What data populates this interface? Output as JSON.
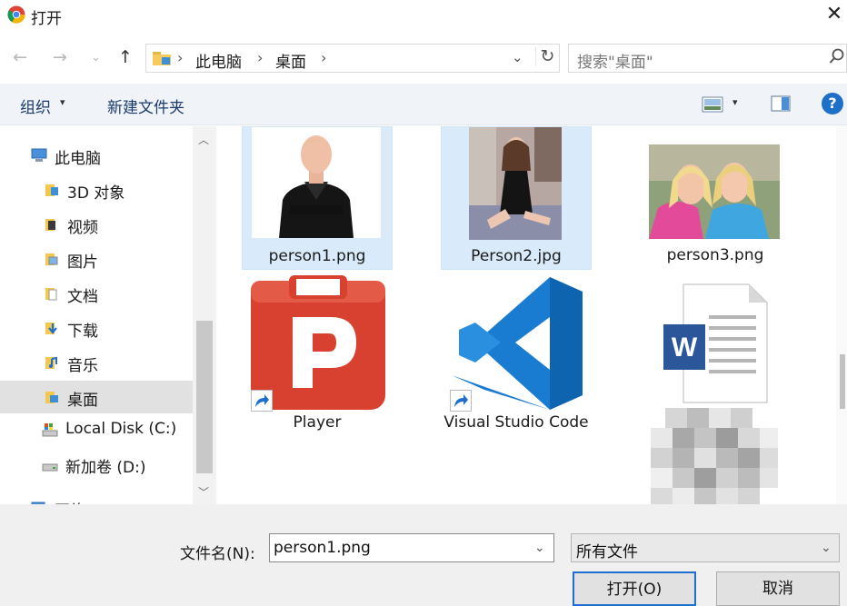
{
  "window": {
    "title": "打开"
  },
  "address": {
    "crumbs": [
      "此电脑",
      "桌面"
    ],
    "search_placeholder": "搜索\"桌面\""
  },
  "toolbar": {
    "organize_label": "组织",
    "new_folder_label": "新建文件夹"
  },
  "nav": {
    "items": [
      {
        "label": "此电脑"
      },
      {
        "label": "3D 对象"
      },
      {
        "label": "视频"
      },
      {
        "label": "图片"
      },
      {
        "label": "文档"
      },
      {
        "label": "下载"
      },
      {
        "label": "音乐"
      },
      {
        "label": "桌面"
      },
      {
        "label": "Local Disk (C:)"
      },
      {
        "label": "新加卷 (D:)"
      },
      {
        "label": "网络"
      }
    ],
    "selected": "桌面"
  },
  "files": [
    {
      "name": "person1.png",
      "selected": true
    },
    {
      "name": "Person2.jpg",
      "selected": true
    },
    {
      "name": "person3.png",
      "selected": false
    },
    {
      "name": "Player",
      "selected": false,
      "shortcut": true
    },
    {
      "name": "Visual Studio Code",
      "selected": false,
      "shortcut": true
    },
    {
      "name": "",
      "selected": false
    }
  ],
  "bottom": {
    "filename_label": "文件名(N):",
    "filename_value": "person1.png",
    "filetype_value": "所有文件",
    "open_label": "打开(O)",
    "cancel_label": "取消"
  },
  "colors": {
    "selection": "#d9ebfb",
    "accent": "#1f6fd0",
    "toolbar_bg": "#f0f4f9"
  }
}
